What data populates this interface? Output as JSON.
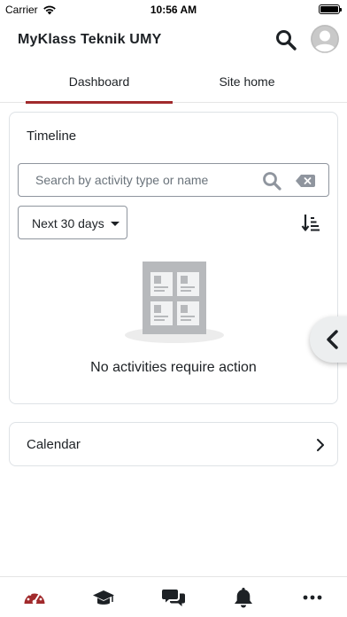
{
  "status_bar": {
    "carrier": "Carrier",
    "time": "10:56 AM"
  },
  "header": {
    "title": "MyKlass Teknik UMY",
    "search_icon": "search-icon",
    "avatar_icon": "user-avatar-icon"
  },
  "tabs": [
    {
      "label": "Dashboard",
      "active": true
    },
    {
      "label": "Site home",
      "active": false
    }
  ],
  "timeline": {
    "title": "Timeline",
    "search_placeholder": "Search by activity type or name",
    "search_value": "",
    "filter_selected": "Next 30 days",
    "empty_message": "No activities require action"
  },
  "calendar": {
    "title": "Calendar"
  },
  "bottom_nav": [
    {
      "icon": "dashboard-gauge-icon",
      "active": true
    },
    {
      "icon": "graduation-cap-icon",
      "active": false
    },
    {
      "icon": "messages-icon",
      "active": false
    },
    {
      "icon": "bell-icon",
      "active": false
    },
    {
      "icon": "more-icon",
      "active": false
    }
  ],
  "colors": {
    "accent": "#a12a2c",
    "text": "#1d2125",
    "border": "#dee2e6",
    "inactive_icon": "#1d2125"
  }
}
